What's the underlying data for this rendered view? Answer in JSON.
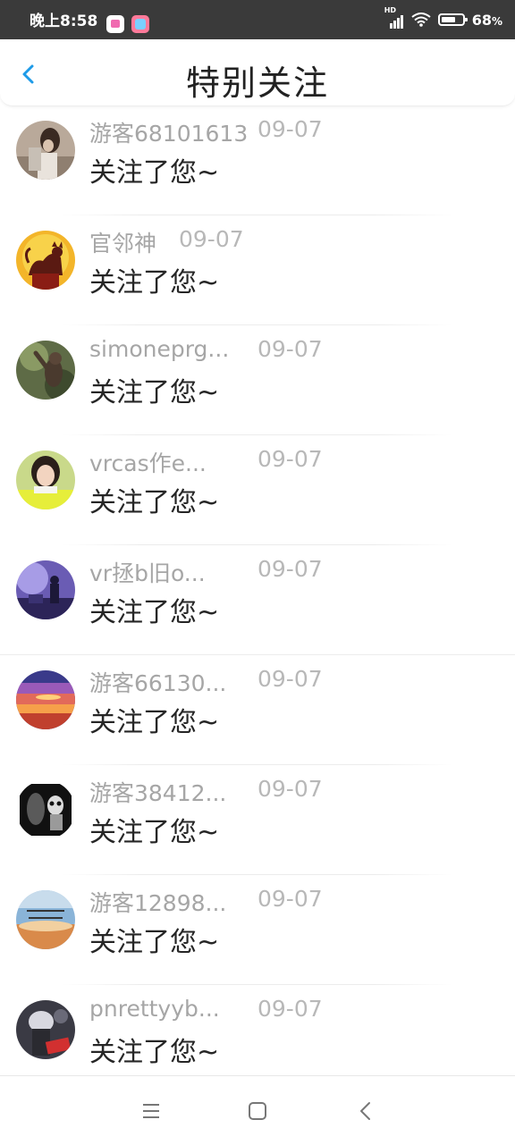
{
  "status_bar": {
    "time": "晚上8:58",
    "network_label": "HD",
    "battery_percent": "68",
    "battery_unit": "%",
    "battery_level": 0.68,
    "icons": [
      "app-icon-notes",
      "app-icon-gallery",
      "signal-icon",
      "wifi-icon",
      "battery-icon"
    ]
  },
  "header": {
    "back_icon": "chevron-left-icon",
    "title": "特别关注",
    "accent_color": "#1e9be8"
  },
  "items": [
    {
      "name": "游客68101613",
      "date": "09-07",
      "message": "关注了您~"
    },
    {
      "name": "官邻神",
      "date": "09-07",
      "message": "关注了您~"
    },
    {
      "name": "simoneprg...",
      "date": "09-07",
      "message": "关注了您~"
    },
    {
      "name": "vrcas作e...",
      "date": "09-07",
      "message": "关注了您~"
    },
    {
      "name": "vr拯b旧o...",
      "date": "09-07",
      "message": "关注了您~"
    },
    {
      "name": "游客66130...",
      "date": "09-07",
      "message": "关注了您~"
    },
    {
      "name": "游客38412...",
      "date": "09-07",
      "message": "关注了您~"
    },
    {
      "name": "游客12898...",
      "date": "09-07",
      "message": "关注了您~"
    },
    {
      "name": "pnrettyyb...",
      "date": "09-07",
      "message": "关注了您~"
    }
  ],
  "nav_bar": {
    "icons": [
      "menu-icon",
      "home-square-icon",
      "back-chevron-icon"
    ]
  }
}
